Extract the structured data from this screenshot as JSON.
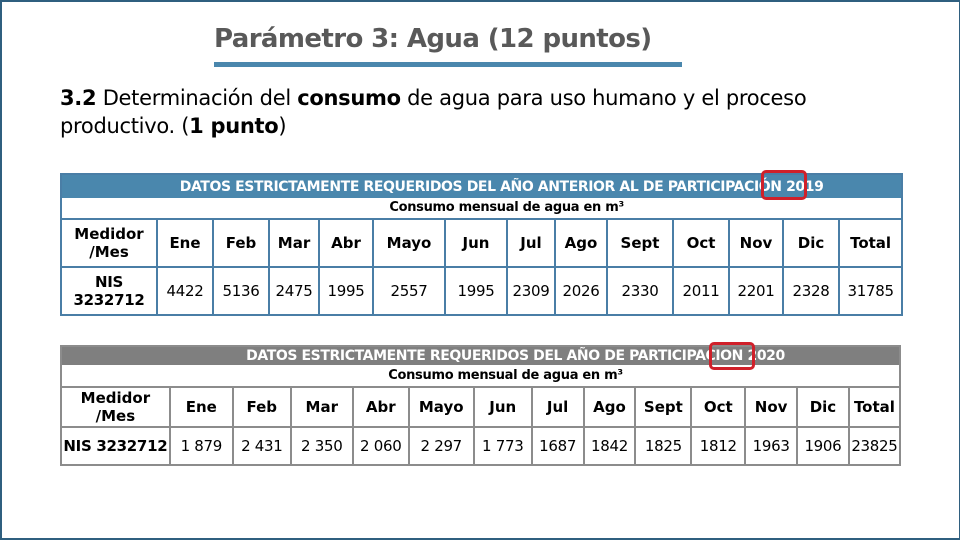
{
  "slide": {
    "title": "Parámetro 3: Agua (12 puntos)",
    "subtitle": {
      "number": "3.2",
      "part1": " Determinación del ",
      "bold_word": "consumo",
      "part2": " de agua para uso humano y el proceso productivo. (",
      "points": "1 punto",
      "part3": ")"
    }
  },
  "table_2019": {
    "header": "DATOS ESTRICTAMENTE REQUERIDOS DEL AÑO ANTERIOR AL DE PARTICIPACIÓN 2019",
    "subheader": "Consumo mensual de agua en m³",
    "header_color": "#4a87ad",
    "row_label_header": "Medidor /Mes",
    "months": [
      "Ene",
      "Feb",
      "Mar",
      "Abr",
      "Mayo",
      "Jun",
      "Jul",
      "Ago",
      "Sept",
      "Oct",
      "Nov",
      "Dic",
      "Total"
    ],
    "meter": "NIS 3232712",
    "values": [
      "4422",
      "5136",
      "2475",
      "1995",
      "2557",
      "1995",
      "2309",
      "2026",
      "2330",
      "2011",
      "2201",
      "2328",
      "31785"
    ]
  },
  "table_2020": {
    "header": "DATOS ESTRICTAMENTE REQUERIDOS DEL AÑO DE PARTICIPACION 2020",
    "subheader": "Consumo mensual de agua en m³",
    "header_color": "#7f7f7f",
    "row_label_header": "Medidor /Mes",
    "months": [
      "Ene",
      "Feb",
      "Mar",
      "Abr",
      "Mayo",
      "Jun",
      "Jul",
      "Ago",
      "Sept",
      "Oct",
      "Nov",
      "Dic",
      "Total"
    ],
    "meter": "NIS 3232712",
    "values": [
      "1 879",
      "2 431",
      "2 350",
      "2 060",
      "2 297",
      "1 773",
      "1687",
      "1842",
      "1825",
      "1812",
      "1963",
      "1906",
      "23825"
    ]
  },
  "annotations": {
    "highlight_color": "#d0202a"
  }
}
